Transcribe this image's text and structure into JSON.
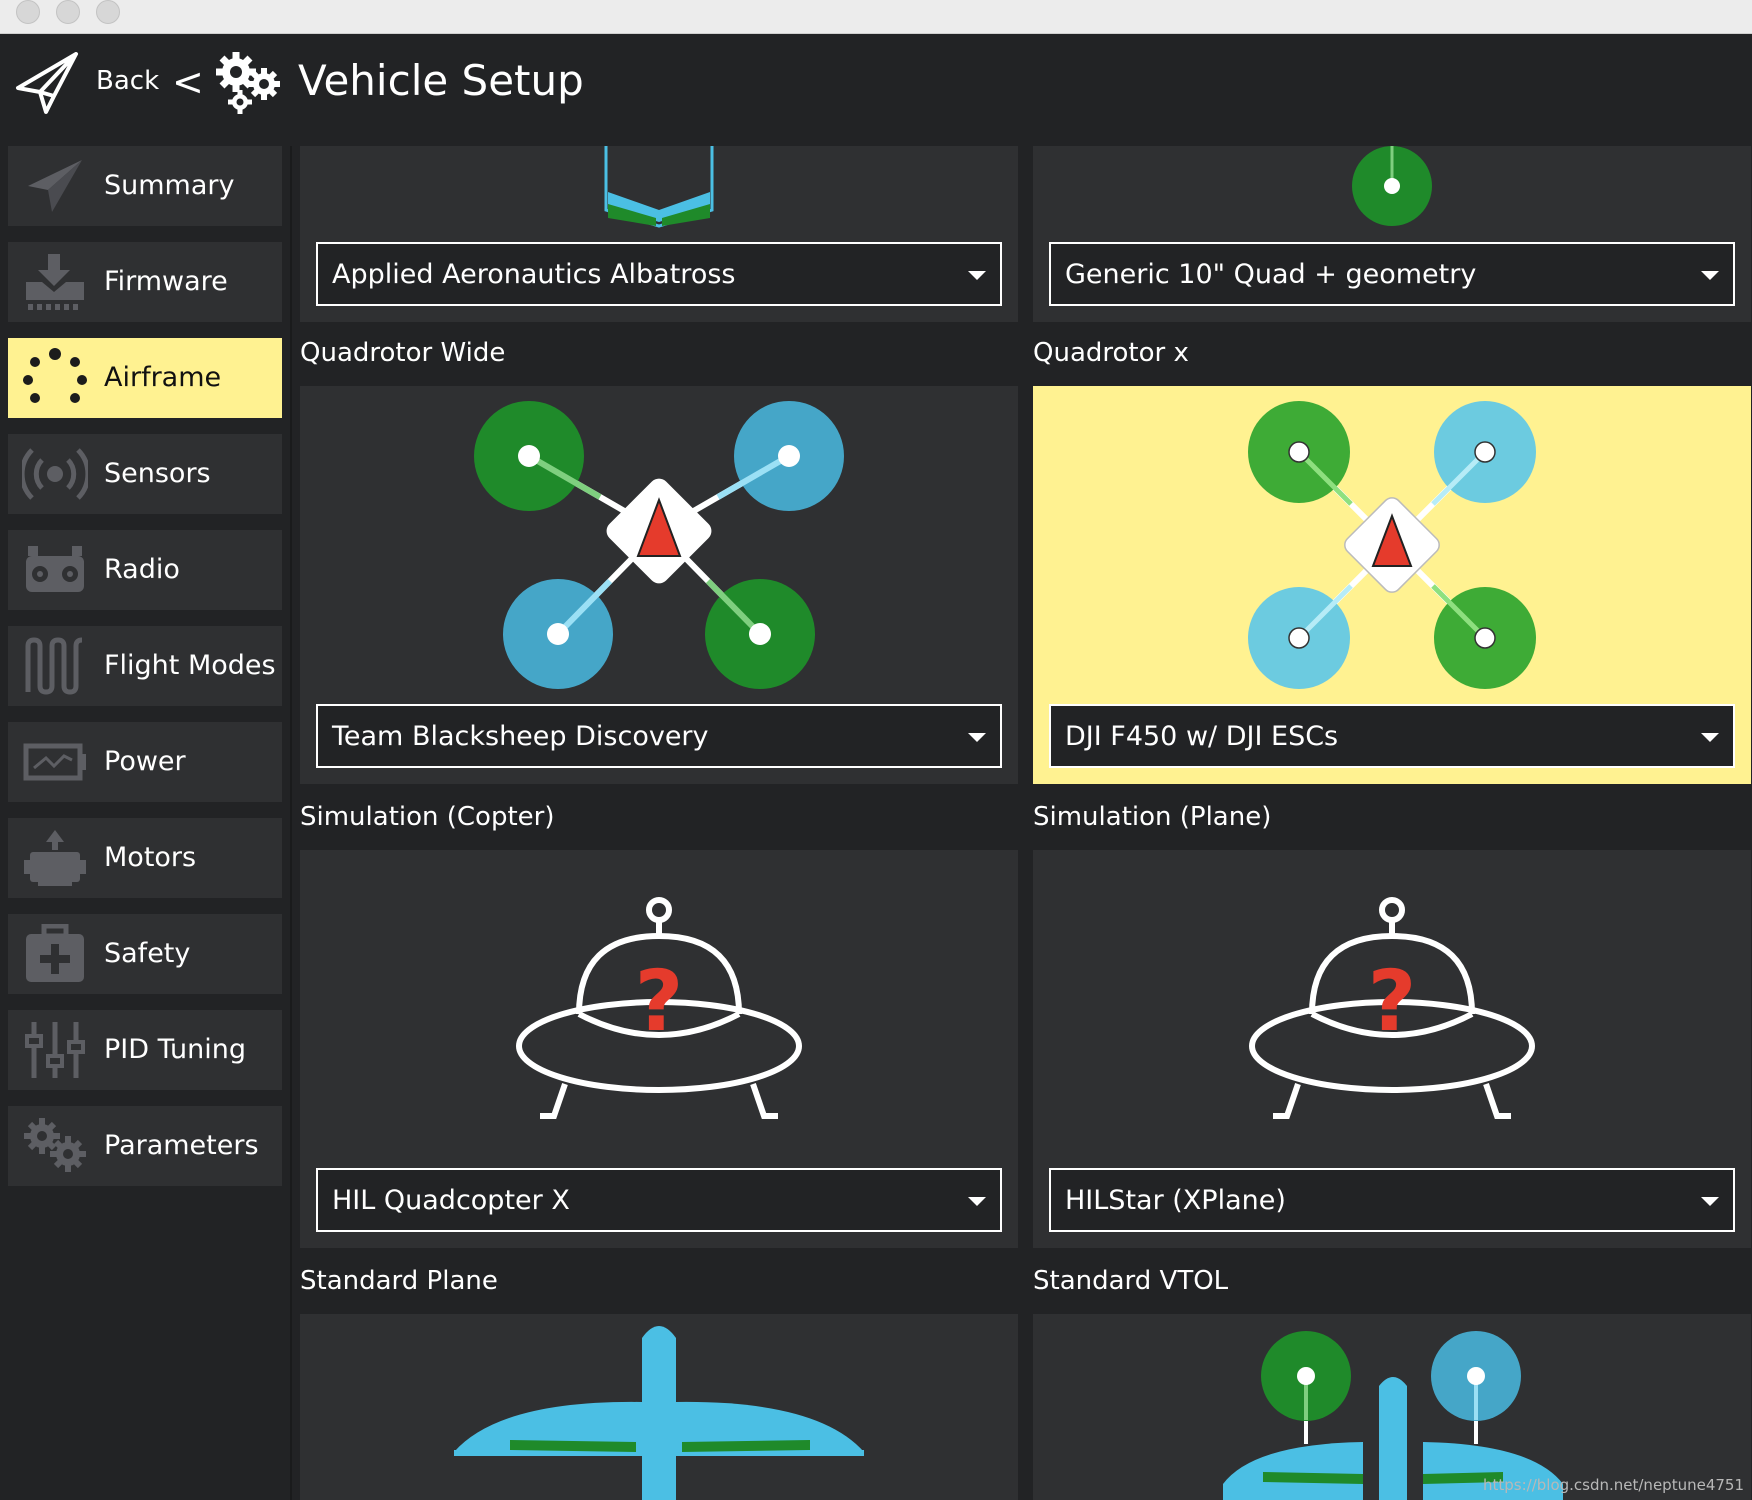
{
  "header": {
    "back_label": "Back",
    "separator": "<",
    "title": "Vehicle Setup"
  },
  "sidebar": {
    "items": [
      {
        "label": "Summary",
        "icon": "paper-plane-icon",
        "active": false
      },
      {
        "label": "Firmware",
        "icon": "download-icon",
        "active": false
      },
      {
        "label": "Airframe",
        "icon": "airframe-dots-icon",
        "active": true
      },
      {
        "label": "Sensors",
        "icon": "sensors-icon",
        "active": false
      },
      {
        "label": "Radio",
        "icon": "radio-icon",
        "active": false
      },
      {
        "label": "Flight Modes",
        "icon": "waveform-icon",
        "active": false
      },
      {
        "label": "Power",
        "icon": "battery-icon",
        "active": false
      },
      {
        "label": "Motors",
        "icon": "motor-icon",
        "active": false
      },
      {
        "label": "Safety",
        "icon": "first-aid-icon",
        "active": false
      },
      {
        "label": "PID Tuning",
        "icon": "sliders-icon",
        "active": false
      },
      {
        "label": "Parameters",
        "icon": "gears-icon",
        "active": false
      }
    ]
  },
  "airframes": {
    "top_left": {
      "selection": "Applied Aeronautics Albatross"
    },
    "top_right": {
      "selection": "Generic 10\" Quad + geometry"
    },
    "quad_wide": {
      "label": "Quadrotor Wide",
      "selection": "Team Blacksheep Discovery"
    },
    "quad_x": {
      "label": "Quadrotor x",
      "selection": "DJI F450 w/ DJI ESCs",
      "selected": true
    },
    "sim_copter": {
      "label": "Simulation (Copter)",
      "selection": "HIL Quadcopter X"
    },
    "sim_plane": {
      "label": "Simulation (Plane)",
      "selection": "HILStar (XPlane)"
    },
    "std_plane": {
      "label": "Standard Plane"
    },
    "std_vtol": {
      "label": "Standard VTOL"
    }
  },
  "colors": {
    "accent_yellow": "#fff291",
    "rotor_green": "#1f8a2a",
    "rotor_blue": "#45a6c8",
    "plane_blue": "#4bbfe4",
    "arrow_red": "#e53b2c"
  },
  "watermark": "https://blog.csdn.net/neptune4751"
}
